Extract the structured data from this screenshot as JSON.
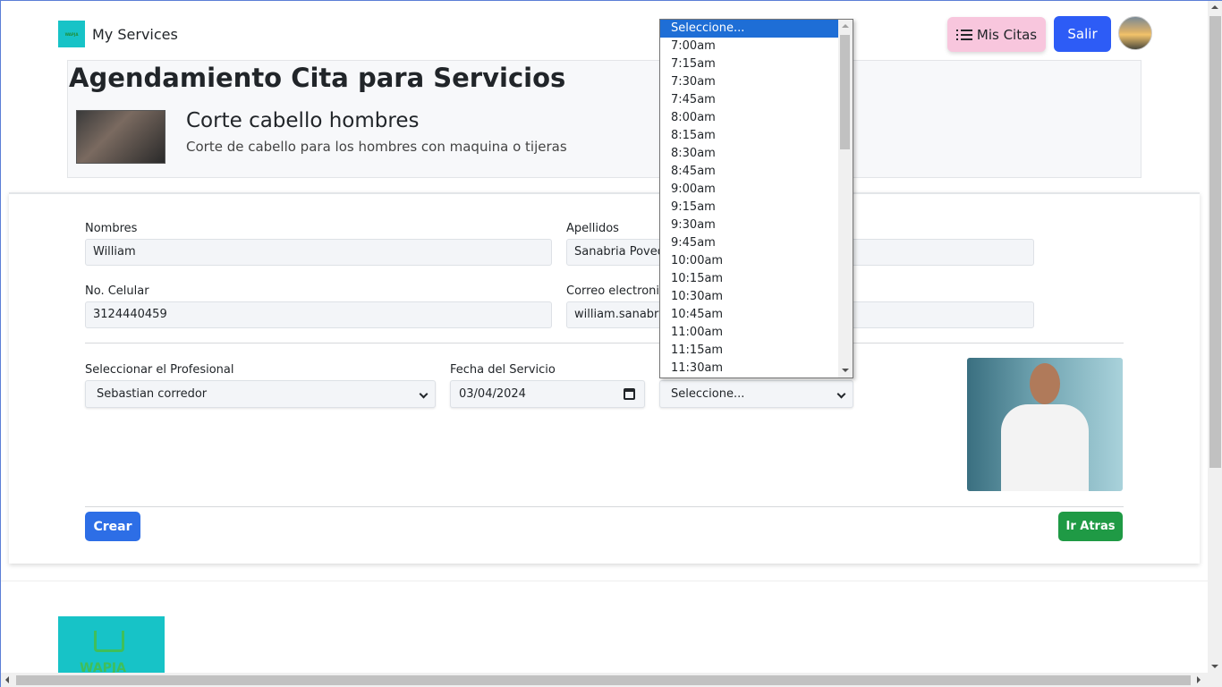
{
  "brand": {
    "name": "My Services",
    "logo_text": "WAPJA"
  },
  "nav": {
    "citas_label": "Mis Citas",
    "salir_label": "Salir"
  },
  "header": {
    "title": "Agendamiento Cita para Servicios",
    "service_title": "Corte cabello hombres",
    "service_desc": "Corte de cabello para los hombres con maquina o tijeras"
  },
  "form": {
    "nombres_label": "Nombres",
    "nombres_value": "William",
    "apellidos_label": "Apellidos",
    "apellidos_value": "Sanabria Poveda",
    "celular_label": "No. Celular",
    "celular_value": "3124440459",
    "correo_label": "Correo electronico",
    "correo_value": "william.sanabria@gmail.com",
    "profesional_label": "Seleccionar el Profesional",
    "profesional_value": "Sebastian corredor",
    "fecha_label": "Fecha del Servicio",
    "fecha_value": "03/04/2024",
    "hora_value": "Seleccione...",
    "crear_label": "Crear",
    "atras_label": "Ir Atras"
  },
  "dropdown": {
    "options": [
      "Seleccione...",
      "7:00am",
      "7:15am",
      "7:30am",
      "7:45am",
      "8:00am",
      "8:15am",
      "8:30am",
      "8:45am",
      "9:00am",
      "9:15am",
      "9:30am",
      "9:45am",
      "10:00am",
      "10:15am",
      "10:30am",
      "10:45am",
      "11:00am",
      "11:15am",
      "11:30am"
    ],
    "selected_index": 0
  },
  "footer": {
    "logo_text": "WAPJA"
  },
  "colors": {
    "primary": "#2d5cf6",
    "success": "#1f9a45",
    "pink": "#f8c6dd",
    "teal": "#17c3c7"
  }
}
